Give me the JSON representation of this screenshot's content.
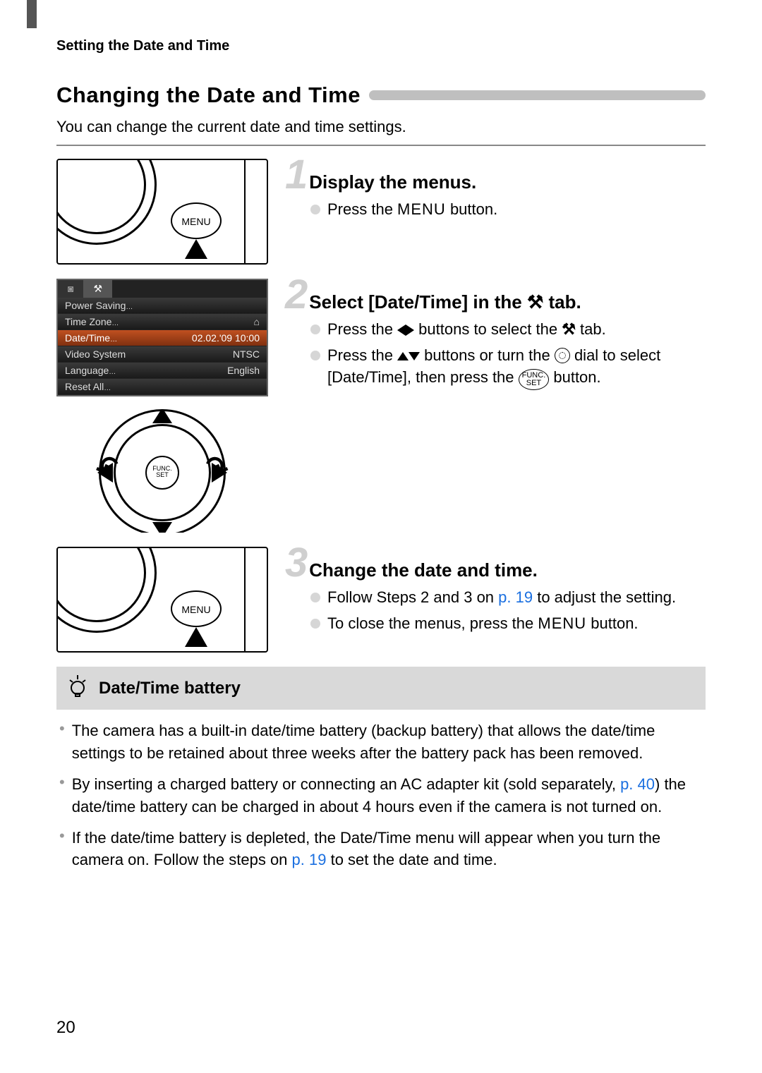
{
  "running_header": "Setting the Date and Time",
  "section_title": "Changing the Date and Time",
  "intro": "You can change the current date and time settings.",
  "steps": [
    {
      "num": "1",
      "title": "Display the menus.",
      "b1_a": "Press the ",
      "b1_menu": "MENU",
      "b1_b": " button."
    },
    {
      "num": "2",
      "title_a": "Select [Date/Time] in the ",
      "title_b": " tab.",
      "b1_a": "Press the ",
      "b1_b": " buttons to select the ",
      "b1_c": " tab.",
      "b2_a": "Press the ",
      "b2_b": " buttons or turn the ",
      "b2_c": " dial to select [Date/Time], then press the ",
      "b2_d": " button."
    },
    {
      "num": "3",
      "title": "Change the date and time.",
      "b1_a": "Follow Steps 2 and 3 on ",
      "b1_link": "p. 19",
      "b1_b": " to adjust the setting.",
      "b2_a": "To close the menus, press the ",
      "b2_menu": "MENU",
      "b2_b": " button."
    }
  ],
  "lcd": {
    "tab_camera": "",
    "tab_tools": "",
    "rows": [
      {
        "label": "Power Saving",
        "value": ""
      },
      {
        "label": "Time Zone",
        "value": ""
      },
      {
        "label": "Date/Time",
        "value": "02.02.'09 10:00"
      },
      {
        "label": "Video System",
        "value": "NTSC"
      },
      {
        "label": "Language",
        "value": "English"
      },
      {
        "label": "Reset All",
        "value": ""
      }
    ]
  },
  "info": {
    "title": "Date/Time battery",
    "items": [
      {
        "a": "The camera has a built-in date/time battery (backup battery) that allows the date/time settings to be retained about three weeks after the battery pack has been removed."
      },
      {
        "a": "By inserting a charged battery or connecting an AC adapter kit (sold separately, ",
        "link": "p. 40",
        "b": ") the date/time battery can be charged in about 4 hours even if the camera is not turned on."
      },
      {
        "a": "If the date/time battery is depleted, the Date/Time menu will appear when you turn the camera on. Follow the steps on ",
        "link": "p. 19",
        "b": " to set the date and time."
      }
    ]
  },
  "page_number": "20",
  "glyphs": {
    "tools": "⚒",
    "home": "⌂",
    "camera": "◙",
    "menu_label": "MENU",
    "func_top": "FUNC.",
    "func_bot": "SET"
  }
}
